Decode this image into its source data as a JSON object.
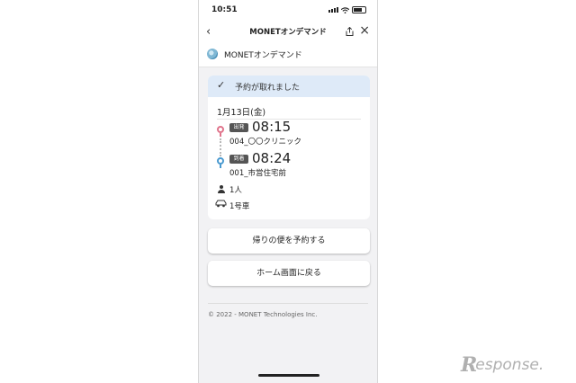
{
  "status_bar": {
    "time": "10:51"
  },
  "nav": {
    "back_icon": "chevron-left-icon",
    "title": "MONETオンデマンド",
    "share_icon": "share-icon",
    "close_icon": "close-icon"
  },
  "header": {
    "logo_icon": "monet-logo-icon",
    "app_name": "MONETオンデマンド"
  },
  "reservation": {
    "banner_text": "予約が取れました",
    "date": "1月13日(金)",
    "departure": {
      "tag": "出発",
      "time": "08:15",
      "stop": "004_〇〇クリニック",
      "color": "#e0748c"
    },
    "arrival": {
      "tag": "到着",
      "time": "08:24",
      "stop": "001_市営住宅前",
      "color": "#4a9ad0"
    },
    "passengers": "1人",
    "vehicle": "1号車",
    "banner_color": "#deeaf8"
  },
  "buttons": {
    "return_trip": "帰りの便を予約する",
    "home": "ホーム画面に戻る"
  },
  "footer": {
    "copyright": "© 2022 - MONET Technologies Inc."
  },
  "watermark": {
    "mark": "R",
    "text": "esponse."
  }
}
